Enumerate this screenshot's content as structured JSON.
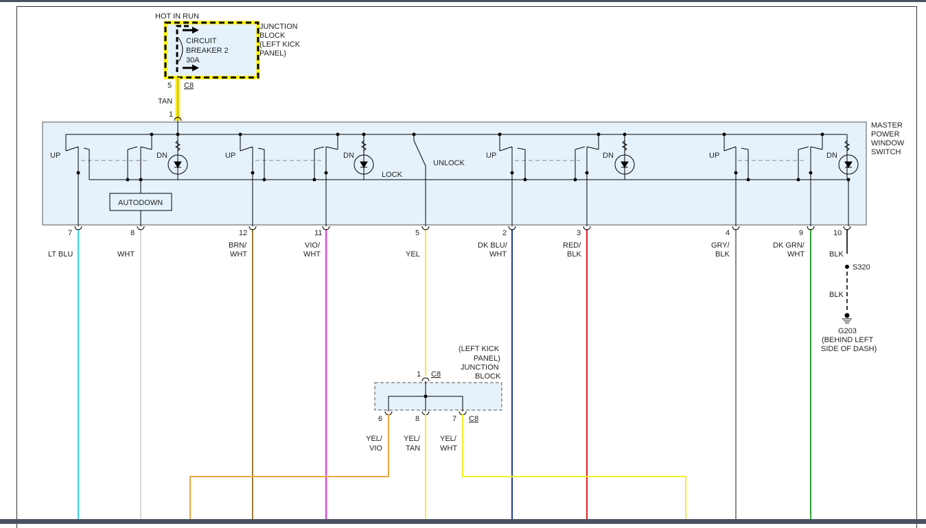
{
  "colors": {
    "module_fill": "#e6f2fb",
    "highlight": "#fff200",
    "wire_lt_blu": "#33d6ea",
    "wire_wht": "#d8d8d8",
    "wire_brn_wht": "#9a7a34",
    "wire_vio_wht": "#ef2ce8",
    "wire_yel": "#f5ee2a",
    "wire_dk_blu_wht": "#1f3d8c",
    "wire_red_blk": "#d81f1f",
    "wire_gry_blk": "#8a8a8a",
    "wire_dk_grn_wht": "#2ea22e",
    "wire_yel_vio": "#f0a840",
    "wire_tan": "#c0b070"
  },
  "top_label": "HOT IN RUN",
  "breaker": {
    "line1": "CIRCUIT",
    "line2": "BREAKER 2",
    "line3": "30A"
  },
  "junction_top": {
    "line1": "JUNCTION",
    "line2": "BLOCK",
    "line3": "(LEFT KICK",
    "line4": "PANEL)"
  },
  "breaker_pin": "5",
  "breaker_conn": "C8",
  "feed_wire": "TAN",
  "feed_pin": "1",
  "master_switch": {
    "line1": "MASTER",
    "line2": "POWER",
    "line3": "WINDOW",
    "line4": "SWITCH"
  },
  "switch_labels": {
    "up": "UP",
    "dn": "DN",
    "autodown": "AUTODOWN",
    "lock": "LOCK",
    "unlock": "UNLOCK"
  },
  "pins": [
    {
      "pin": "7",
      "wire1": "LT BLU",
      "wire2": ""
    },
    {
      "pin": "8",
      "wire1": "WHT",
      "wire2": ""
    },
    {
      "pin": "12",
      "wire1": "BRN/",
      "wire2": "WHT"
    },
    {
      "pin": "11",
      "wire1": "VIO/",
      "wire2": "WHT"
    },
    {
      "pin": "5",
      "wire1": "YEL",
      "wire2": ""
    },
    {
      "pin": "2",
      "wire1": "DK BLU/",
      "wire2": "WHT"
    },
    {
      "pin": "3",
      "wire1": "RED/",
      "wire2": "BLK"
    },
    {
      "pin": "4",
      "wire1": "GRY/",
      "wire2": "BLK"
    },
    {
      "pin": "9",
      "wire1": "DK GRN/",
      "wire2": "WHT"
    },
    {
      "pin": "10",
      "wire1": "BLK",
      "wire2": ""
    }
  ],
  "splice": {
    "name": "S320",
    "wire_after": "BLK"
  },
  "ground": {
    "name": "G203",
    "line1": "(BEHIND LEFT",
    "line2": "SIDE OF DASH)"
  },
  "junction_bottom": {
    "line1": "(LEFT KICK",
    "line2": "PANEL)",
    "line3": "JUNCTION",
    "line4": "BLOCK",
    "in_pin": "1",
    "in_conn": "C8",
    "out_pins": [
      {
        "pin": "6",
        "wire1": "YEL/",
        "wire2": "VIO"
      },
      {
        "pin": "8",
        "wire1": "YEL/",
        "wire2": "TAN"
      },
      {
        "pin": "7",
        "wire1": "YEL/",
        "wire2": "WHT"
      }
    ],
    "out_conn": "C8"
  }
}
